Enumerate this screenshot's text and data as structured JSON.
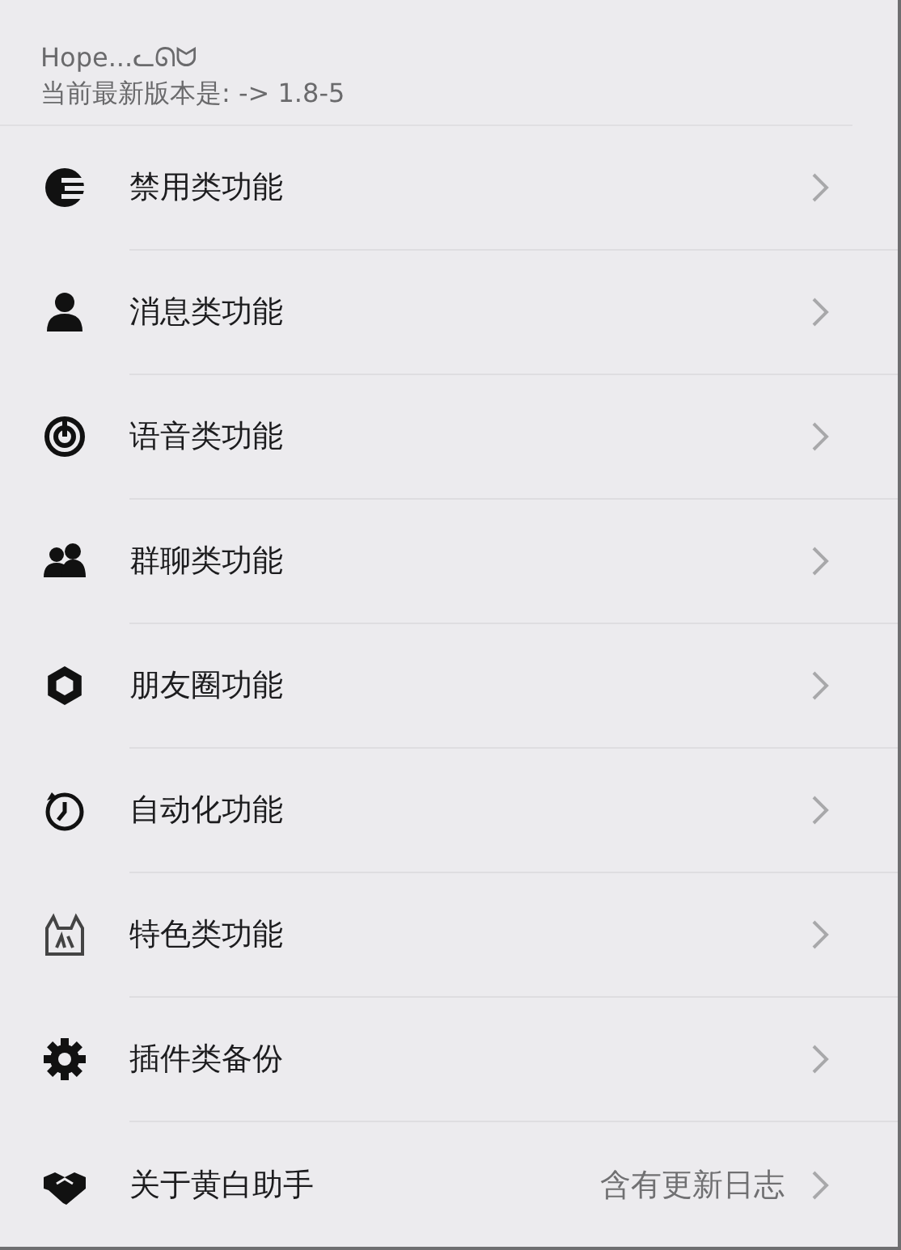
{
  "header": {
    "title": "Hope...ᓚᘏᗢ",
    "version": "当前最新版本是: -> 1.8-5"
  },
  "items": [
    {
      "label": "禁用类功能"
    },
    {
      "label": "消息类功能"
    },
    {
      "label": "语音类功能"
    },
    {
      "label": "群聊类功能"
    },
    {
      "label": "朋友圈功能"
    },
    {
      "label": "自动化功能"
    },
    {
      "label": "特色类功能"
    },
    {
      "label": "插件类备份"
    },
    {
      "label": "关于黄白助手",
      "detail": "含有更新日志"
    }
  ]
}
